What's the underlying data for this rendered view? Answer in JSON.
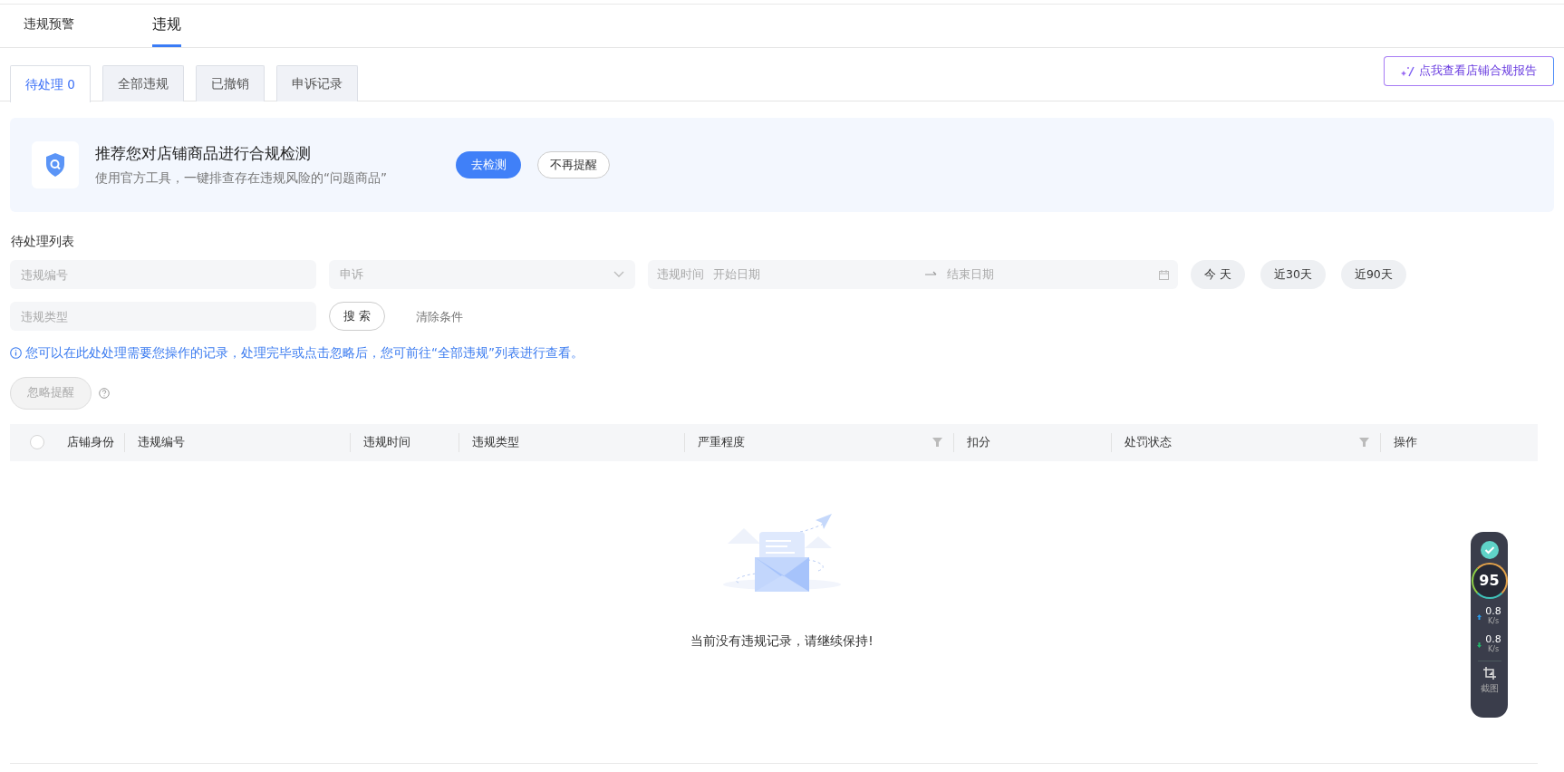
{
  "top_tabs": [
    {
      "label": "违规预警",
      "selected": false
    },
    {
      "label": "违规",
      "selected": true
    }
  ],
  "sub_tabs": [
    {
      "label": "待处理 0",
      "selected": true
    },
    {
      "label": "全部违规",
      "selected": false
    },
    {
      "label": "已撤销",
      "selected": false
    },
    {
      "label": "申诉记录",
      "selected": false
    }
  ],
  "report_button": "点我查看店铺合规报告",
  "banner": {
    "title": "推荐您对店铺商品进行合规检测",
    "subtitle": "使用官方工具，一键排查存在违规风险的“问题商品”",
    "primary_button": "去检测",
    "secondary_button": "不再提醒"
  },
  "list_title": "待处理列表",
  "filters": {
    "id_placeholder": "违规编号",
    "appeal_placeholder": "申诉",
    "time_label": "违规时间",
    "start_placeholder": "开始日期",
    "end_placeholder": "结束日期",
    "quick_ranges": [
      "今 天",
      "近30天",
      "近90天"
    ],
    "type_placeholder": "违规类型",
    "search_button": "搜 索",
    "clear_button": "清除条件"
  },
  "info": "您可以在此处处理需要您操作的记录，处理完毕或点击忽略后，您可前往“全部违规”列表进行查看。",
  "ignore_button": {
    "label": "忽略提醒",
    "disabled": true
  },
  "table": {
    "select_all_checked": false,
    "columns": [
      {
        "label": "店铺身份",
        "filterable": false
      },
      {
        "label": "违规编号",
        "filterable": false
      },
      {
        "label": "违规时间",
        "filterable": false
      },
      {
        "label": "违规类型",
        "filterable": false
      },
      {
        "label": "严重程度",
        "filterable": true
      },
      {
        "label": "扣分",
        "filterable": false
      },
      {
        "label": "处罚状态",
        "filterable": true
      },
      {
        "label": "操作",
        "filterable": false
      }
    ],
    "empty_text": "当前没有违规记录，请继续保持!"
  },
  "widget": {
    "score": "95",
    "up_speed": "0.8",
    "up_unit": "K/s",
    "down_speed": "0.8",
    "down_unit": "K/s",
    "screenshot_label": "截图"
  }
}
